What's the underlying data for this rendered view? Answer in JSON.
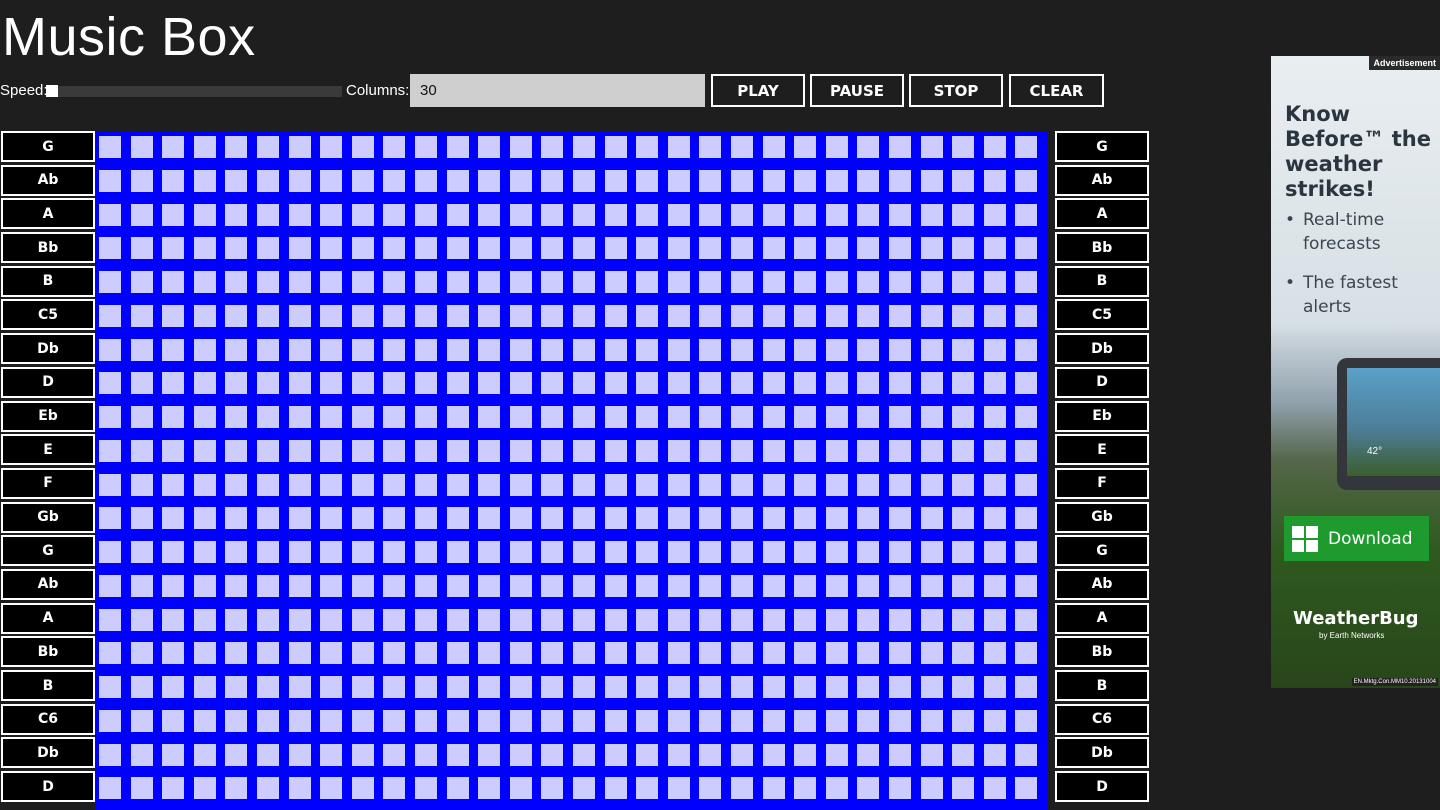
{
  "app": {
    "title": "Music Box"
  },
  "controls": {
    "speed_label": "Speed:",
    "speed_value": 0.0,
    "columns_label": "Columns:",
    "columns_value": "30",
    "buttons": {
      "play": "PLAY",
      "pause": "PAUSE",
      "stop": "STOP",
      "clear": "CLEAR"
    }
  },
  "notes": [
    "G",
    "Ab",
    "A",
    "Bb",
    "B",
    "C5",
    "Db",
    "D",
    "Eb",
    "E",
    "F",
    "Gb",
    "G",
    "Ab",
    "A",
    "Bb",
    "B",
    "C6",
    "Db",
    "D"
  ],
  "grid": {
    "columns": 30,
    "visible_rows": 20,
    "background": "#0000ff",
    "cell_color": "#ccccff"
  },
  "ad": {
    "tag": "Advertisement",
    "headline": "Know Before™ the weather strikes!",
    "bullets": [
      "Real-time forecasts",
      "The fastest alerts"
    ],
    "tablet_temp": "42°",
    "download_label": "Download",
    "brand": "WeatherBug",
    "brand_sub": "by Earth Networks",
    "code": "EN.Mktg.Con.MM10.20131004"
  }
}
